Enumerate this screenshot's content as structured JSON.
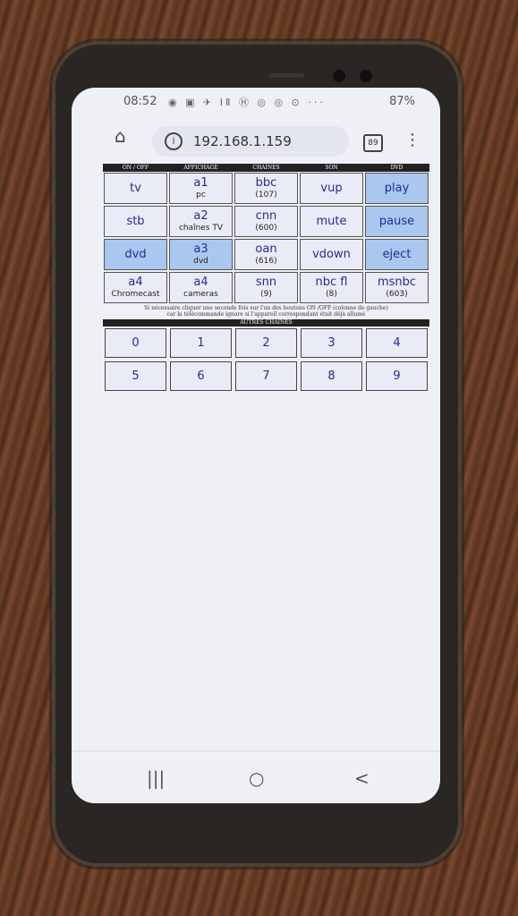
{
  "status": {
    "time": "08:52",
    "icons": "◉ ▣ ✈ ⅠⅡ Ⓗ ◎ ◎ ⊙ ···",
    "battery": "87%"
  },
  "browser": {
    "url": "192.168.1.159",
    "tab_count": "89"
  },
  "remote": {
    "headers": [
      "ON / OFF",
      "AFFICHAGE",
      "CHAINES",
      "SON",
      "DVD"
    ],
    "rows": [
      [
        {
          "main": "tv",
          "sub": "",
          "on": false
        },
        {
          "main": "a1",
          "sub": "pc",
          "on": false
        },
        {
          "main": "bbc",
          "sub": "(107)",
          "on": false
        },
        {
          "main": "vup",
          "sub": "",
          "on": false
        },
        {
          "main": "play",
          "sub": "",
          "on": true
        }
      ],
      [
        {
          "main": "stb",
          "sub": "",
          "on": false
        },
        {
          "main": "a2",
          "sub": "chaînes TV",
          "on": false
        },
        {
          "main": "cnn",
          "sub": "(600)",
          "on": false
        },
        {
          "main": "mute",
          "sub": "",
          "on": false
        },
        {
          "main": "pause",
          "sub": "",
          "on": true
        }
      ],
      [
        {
          "main": "dvd",
          "sub": "",
          "on": true
        },
        {
          "main": "a3",
          "sub": "dvd",
          "on": true
        },
        {
          "main": "oan",
          "sub": "(616)",
          "on": false
        },
        {
          "main": "vdown",
          "sub": "",
          "on": false
        },
        {
          "main": "eject",
          "sub": "",
          "on": true
        }
      ],
      [
        {
          "main": "a4",
          "sub": "Chromecast",
          "on": false
        },
        {
          "main": "a4",
          "sub": "cameras",
          "on": false
        },
        {
          "main": "snn",
          "sub": "(9)",
          "on": false
        },
        {
          "main": "nbc fl",
          "sub": "(8)",
          "on": false
        },
        {
          "main": "msnbc",
          "sub": "(603)",
          "on": false
        }
      ]
    ],
    "note_line1": "Si nécessaire cliquer une seconde fois sur l'un des boutons ON /OFF (colonne de gauche)",
    "note_line2": "car la télécommande ignore si l'appareil correspondant était déjà allumé",
    "other_channels_header": "AUTRES CHAINES",
    "digits": [
      [
        "0",
        "1",
        "2",
        "3",
        "4"
      ],
      [
        "5",
        "6",
        "7",
        "8",
        "9"
      ]
    ]
  },
  "navbar": {
    "recent": "|||",
    "home": "○",
    "back": "<"
  }
}
